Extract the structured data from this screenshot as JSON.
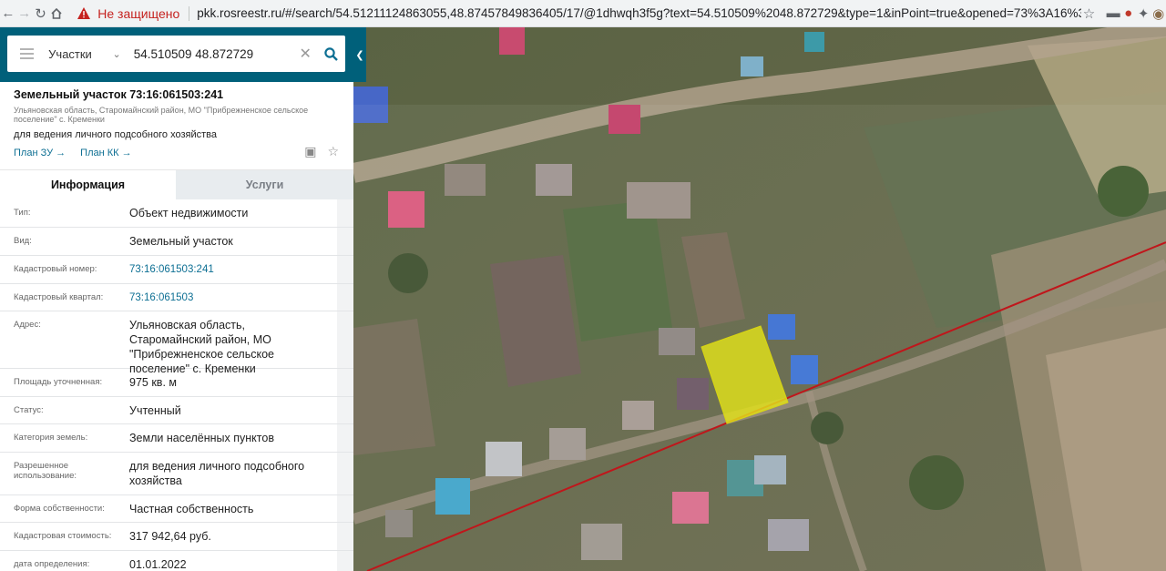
{
  "browser": {
    "insecure_label": "Не защищено",
    "url": "pkk.rosreestr.ru/#/search/54.51211124863055,48.87457849836405/17/@1dhwqh3f5g?text=54.510509%2048.872729&type=1&inPoint=true&opened=73%3A16%3A6..."
  },
  "search": {
    "type_label": "Участки",
    "query": "54.510509 48.872729"
  },
  "object": {
    "title": "Земельный участок 73:16:061503:241",
    "address": "Ульяновская область, Старомайнский район, МО \"Прибрежненское сельское поселение\" с. Кременки",
    "usage": "для ведения личного подсобного хозяйства",
    "plan_zu": "План ЗУ",
    "plan_kk": "План КК"
  },
  "tabs": {
    "info": "Информация",
    "services": "Услуги"
  },
  "fields": [
    {
      "label": "Тип:",
      "value": "Объект недвижимости"
    },
    {
      "label": "Вид:",
      "value": "Земельный участок"
    },
    {
      "label": "Кадастровый номер:",
      "value": "73:16:061503:241"
    },
    {
      "label": "Кадастровый квартал:",
      "value": "73:16:061503"
    },
    {
      "label": "Адрес:",
      "value": "Ульяновская область, Старомайнский район, МО \"Прибрежненское сельское поселение\" с. Кременки"
    },
    {
      "label": "Площадь уточненная:",
      "value": "975 кв. м"
    },
    {
      "label": "Статус:",
      "value": "Учтенный"
    },
    {
      "label": "Категория земель:",
      "value": "Земли населённых пунктов"
    },
    {
      "label": "Разрешенное использование:",
      "value": "для ведения личного подсобного хозяйства"
    },
    {
      "label": "Форма собственности:",
      "value": "Частная собственность"
    },
    {
      "label": "Кадастровая стоимость:",
      "value": "317 942,64 руб."
    },
    {
      "label": "дата определения:",
      "value": "01.01.2022"
    }
  ],
  "colors": {
    "header_teal": "#00607a",
    "link": "#0d6f93",
    "parcel_fill": "#e2e21a",
    "boundary_line": "#c0161b",
    "insecure": "#c5221f"
  },
  "icons": [
    "back-icon",
    "forward-icon",
    "reload-icon",
    "home-icon",
    "warning-icon",
    "bookmark-star-icon",
    "menu-icon",
    "search-icon",
    "clear-icon",
    "collapse-chevron-icon",
    "print-preview-icon",
    "favorite-star-icon"
  ]
}
